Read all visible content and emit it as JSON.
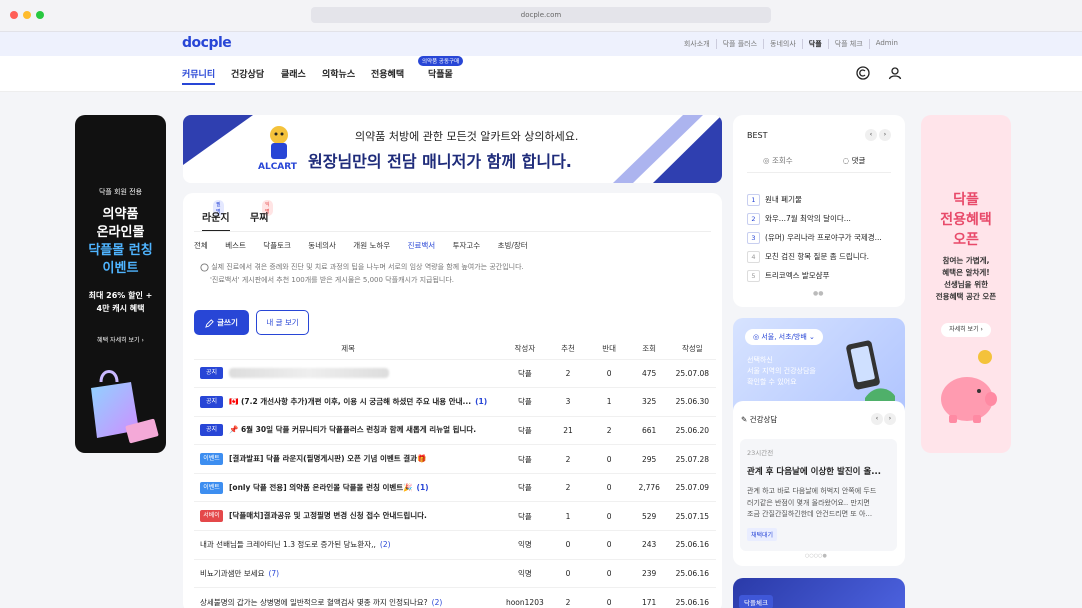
{
  "browser": {
    "url": "docple.com"
  },
  "header": {
    "logo": "docple",
    "util_links": [
      "회사소개",
      "닥플 플러스",
      "동네의사",
      "닥플",
      "닥플 체크",
      "Admin"
    ],
    "active_util": "닥플",
    "nav": [
      "커뮤니티",
      "건강상담",
      "클래스",
      "의학뉴스",
      "전용혜택",
      "닥플몰"
    ],
    "nav_badge": "의약품 공동구매"
  },
  "left_ad": {
    "line1": "닥플 회원 전용",
    "line2": "의약품",
    "line3": "온라인몰",
    "line4": "닥플몰 런칭",
    "line5": "이벤트",
    "line6": "최대 26% 할인 +",
    "line7": "4만 캐시 혜택",
    "cta": "혜택 자세히 보기"
  },
  "banner": {
    "brand": "ALCART",
    "line1": "의약품 처방에 관한 모든것 알카트와 상의하세요.",
    "line2": "원장님만의 전담 매니저가 함께 합니다."
  },
  "board": {
    "tabs": [
      {
        "label": "라운지",
        "badge": "필명"
      },
      {
        "label": "무찌",
        "badge": "익명"
      }
    ],
    "categories": [
      "전체",
      "베스트",
      "닥플토크",
      "동네의사",
      "개원 노하우",
      "진료백서",
      "투자고수",
      "초빙/장터"
    ],
    "active_category": "진료백서",
    "info_line1": "실제 진료에서 겪은 증례와 진단 및 치료 과정의 팁을 나누며 서로의 임상 역량을 함께 높여가는 공간입니다.",
    "info_line2": "'진료백서' 게시판에서 추천 100개를 받은 게시물은 5,000 닥플캐시가 지급됩니다.",
    "write_button": "글쓰기",
    "my_posts_button": "내 글 보기",
    "columns": [
      "제목",
      "작성자",
      "추천",
      "반대",
      "조회",
      "작성일"
    ],
    "rows": [
      {
        "tag": "공지",
        "tag_color": "#2846d6",
        "title": "",
        "count": "",
        "author": "닥플",
        "up": "2",
        "down": "0",
        "views": "475",
        "date": "25.07.08"
      },
      {
        "tag": "공지",
        "tag_color": "#2846d6",
        "title": "🇨🇦 (7.2 개선사항 추가)개편 이후, 이용 시 궁금해 하셨던 주요 내용 안내...",
        "count": "(1)",
        "author": "닥플",
        "up": "3",
        "down": "1",
        "views": "325",
        "date": "25.06.30"
      },
      {
        "tag": "공지",
        "tag_color": "#2846d6",
        "title": "📌 6월 30일 닥플 커뮤니티가 닥플플러스 런칭과 함께 새롭게 리뉴얼 됩니다.",
        "count": "",
        "author": "닥플",
        "up": "21",
        "down": "2",
        "views": "661",
        "date": "25.06.20"
      },
      {
        "tag": "이벤트",
        "tag_color": "#3d8ef0",
        "title": "[결과발표] 닥플 라운지(필명게시판) 오픈 기념 이벤트 결과🎁",
        "count": "",
        "author": "닥플",
        "up": "2",
        "down": "0",
        "views": "295",
        "date": "25.07.28"
      },
      {
        "tag": "이벤트",
        "tag_color": "#3d8ef0",
        "title": "[only 닥플 전용] 의약품 온라인몰 닥플몰 런칭 이벤트🎉",
        "count": "(1)",
        "author": "닥플",
        "up": "2",
        "down": "0",
        "views": "2,776",
        "date": "25.07.09"
      },
      {
        "tag": "서베이",
        "tag_color": "#e4484a",
        "title": "[닥플매치]결과공유 및 고정필명 변경 신청 접수 안내드립니다.",
        "count": "",
        "author": "닥플",
        "up": "1",
        "down": "0",
        "views": "529",
        "date": "25.07.15"
      },
      {
        "tag": "",
        "tag_color": "",
        "title": "내과 선배님들 크레아티닌 1.3 정도로 증가된 당뇨환자,,",
        "count": "(2)",
        "author": "익명",
        "up": "0",
        "down": "0",
        "views": "243",
        "date": "25.06.16"
      },
      {
        "tag": "",
        "tag_color": "",
        "title": "비뇨기과샘만 보세요",
        "count": "(7)",
        "author": "익명",
        "up": "0",
        "down": "0",
        "views": "239",
        "date": "25.06.16"
      },
      {
        "tag": "",
        "tag_color": "",
        "title": "상세불명의 갑가는 상병명에 일반적으로 혈액검사 몇종 까지 인정되나요?",
        "count": "(2)",
        "author": "hoon1203",
        "up": "2",
        "down": "0",
        "views": "171",
        "date": "25.06.16"
      }
    ]
  },
  "best": {
    "title": "BEST",
    "tab_views": "조회수",
    "tab_comments": "댓글",
    "items": [
      {
        "rank": "1",
        "text": "원내 폐기물"
      },
      {
        "rank": "2",
        "text": "와우...7월 최악의 달이다..."
      },
      {
        "rank": "3",
        "text": "(유머) 우리나라 프로야구가 국제경..."
      },
      {
        "rank": "4",
        "text": "모친 검진 항목 질문 좀 드립니다."
      },
      {
        "rank": "5",
        "text": "트리코멕스 발모샴푸"
      }
    ]
  },
  "region": {
    "select": "서울, 서초/방배",
    "line1": "선택하신",
    "line2": "서울 지역의 건강상담을",
    "line3": "확인할 수 있어요"
  },
  "consult": {
    "title": "건강상담",
    "time": "23시간전",
    "headline": "관계 후 다음날에 이상한 발진이 올...",
    "body1": "관계 하고 바로 다음날에 허벅지 안쪽에 두드",
    "body2": "러기같은 반점이 몇개 올라왔어요.. 만지면",
    "body3": "조금 간질간질하긴한데 안건드리면 또 아...",
    "status": "채택대기"
  },
  "right_ad": {
    "line1": "닥플",
    "line2": "전용혜택",
    "line3": "오픈",
    "line4": "참여는 가볍게,",
    "line5": "혜택은 알차게!",
    "line6": "선생님을 위한",
    "line7": "전용혜택 공간 오픈",
    "cta": "자세히 보기"
  },
  "bottom_card": {
    "tag": "닥플체크"
  }
}
